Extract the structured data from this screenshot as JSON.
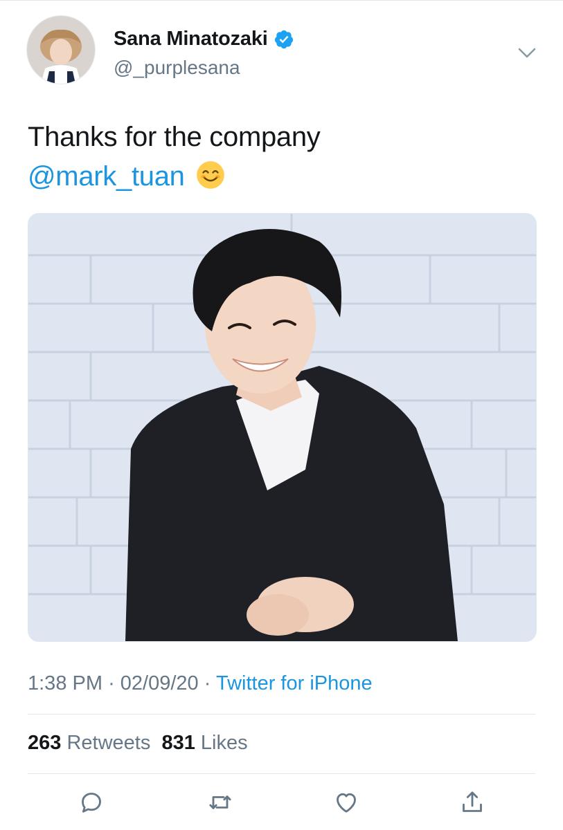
{
  "tweet": {
    "author": {
      "display_name": "Sana Minatozaki",
      "handle": "@_purplesana",
      "verified": true
    },
    "text_line1": "Thanks for the company",
    "mention": "@mark_tuan",
    "emoji": "smiling-face-icon",
    "time": "1:38 PM",
    "date": "02/09/20",
    "separator": "·",
    "source": "Twitter for iPhone",
    "retweets_count": "263",
    "retweets_label": "Retweets",
    "likes_count": "831",
    "likes_label": "Likes"
  },
  "actions": [
    "reply-icon",
    "retweet-icon",
    "like-icon",
    "share-icon"
  ],
  "colors": {
    "accent": "#1b95e0",
    "secondary_text": "#657786",
    "primary_text": "#14171a",
    "divider": "#e1e8ed"
  }
}
